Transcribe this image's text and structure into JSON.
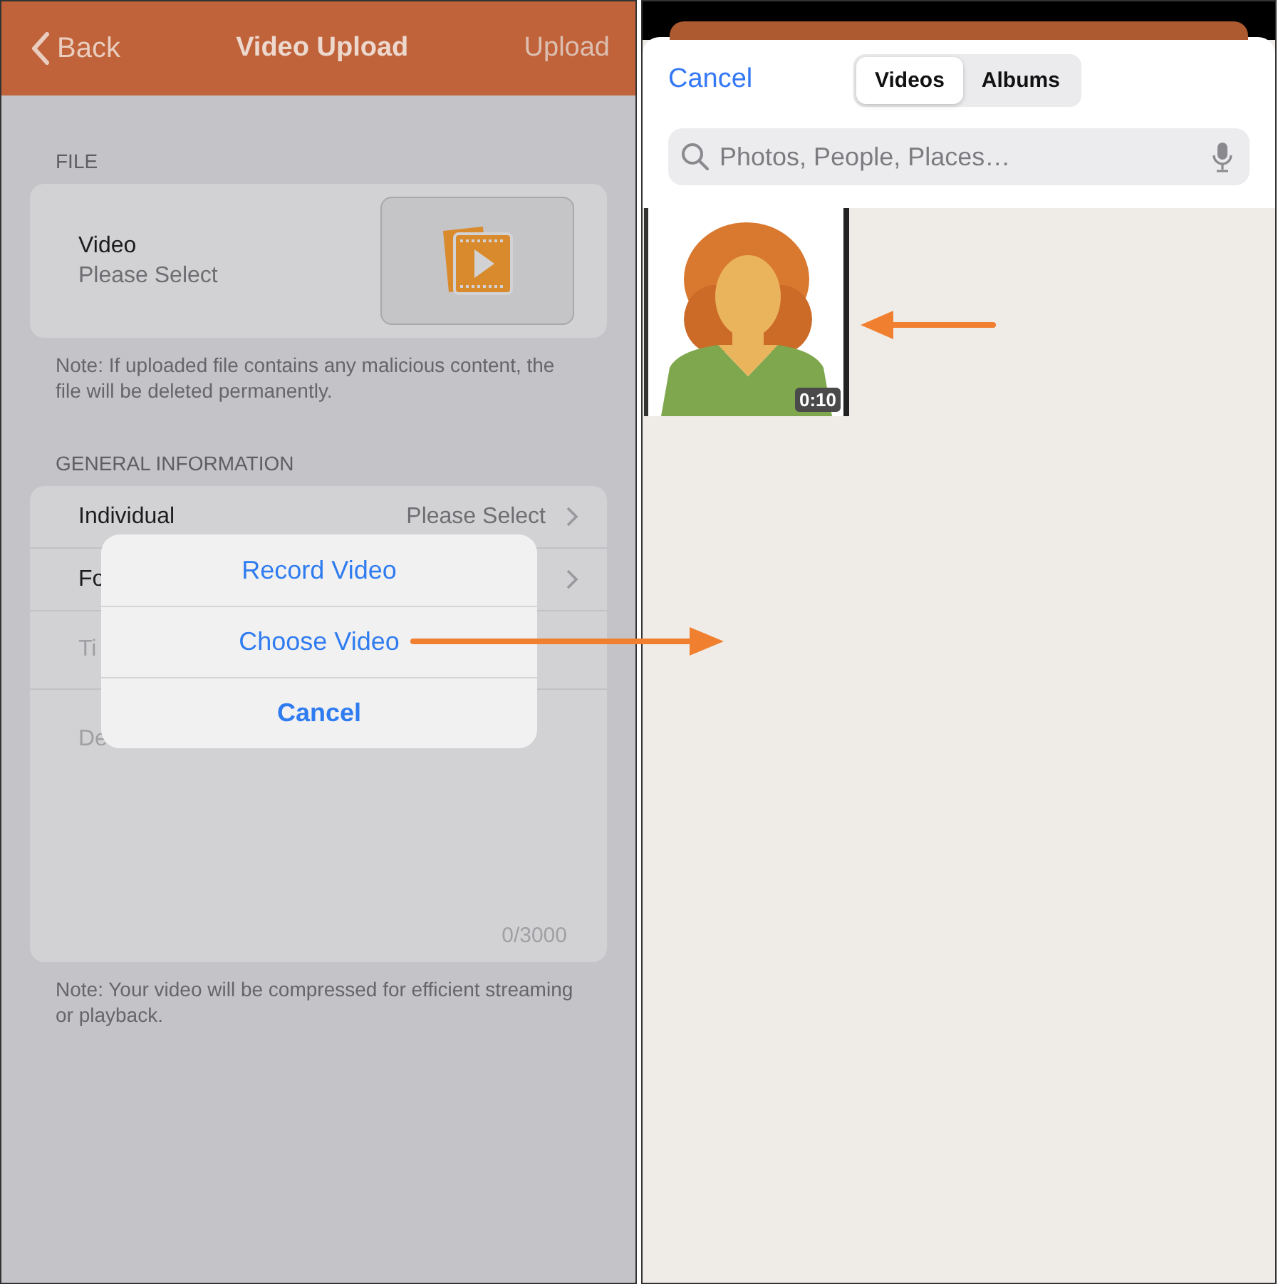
{
  "left": {
    "nav": {
      "back": "Back",
      "title": "Video Upload",
      "action": "Upload"
    },
    "file_section": {
      "header": "FILE",
      "label": "Video",
      "value": "Please Select",
      "note": "Note: If uploaded file contains any malicious content, the file will be deleted permanently."
    },
    "general_section": {
      "header": "GENERAL INFORMATION",
      "rows": [
        {
          "label": "Individual",
          "value": "Please Select",
          "kind": "select"
        },
        {
          "label": "Fo",
          "kind": "select"
        },
        {
          "label": "Ti",
          "kind": "text"
        },
        {
          "label": "De",
          "kind": "textarea",
          "counter": "0/3000"
        }
      ],
      "note": "Note: Your video will be compressed for efficient streaming or playback."
    },
    "action_sheet": [
      {
        "label": "Record Video",
        "kind": "action"
      },
      {
        "label": "Choose Video",
        "kind": "action"
      },
      {
        "label": "Cancel",
        "kind": "cancel"
      }
    ]
  },
  "right": {
    "cancel": "Cancel",
    "segments": [
      {
        "label": "Videos",
        "selected": true
      },
      {
        "label": "Albums",
        "selected": false
      }
    ],
    "search": {
      "placeholder": "Photos, People, Places…"
    },
    "videos": [
      {
        "kind": "picture",
        "duration": "0:10"
      }
    ]
  }
}
